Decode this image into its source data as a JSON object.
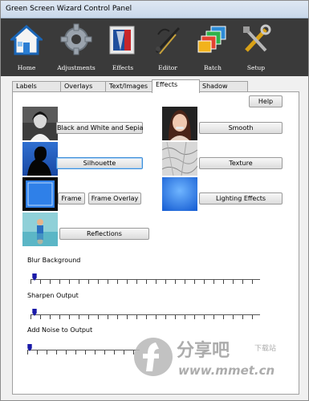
{
  "window": {
    "title": "Green Screen Wizard Control Panel"
  },
  "toolbar": {
    "items": [
      {
        "label": "Home",
        "icon": "home-icon"
      },
      {
        "label": "Adjustments",
        "icon": "gear-icon"
      },
      {
        "label": "Effects",
        "icon": "effects-icon"
      },
      {
        "label": "Editor",
        "icon": "editor-icon"
      },
      {
        "label": "Batch",
        "icon": "batch-icon"
      },
      {
        "label": "Setup",
        "icon": "setup-icon"
      }
    ]
  },
  "tabs": [
    {
      "label": "Labels"
    },
    {
      "label": "Overlays"
    },
    {
      "label": "Text/Images"
    },
    {
      "label": "Effects",
      "active": true
    },
    {
      "label": "Shadow"
    }
  ],
  "effects": {
    "help": "Help",
    "bw_sepia": "Black and White and Sepia",
    "silhouette": "Silhouette",
    "frame": "Frame",
    "frame_overlay": "Frame Overlay",
    "reflections": "Reflections",
    "smooth": "Smooth",
    "texture": "Texture",
    "lighting": "Lighting Effects"
  },
  "sliders": [
    {
      "label": "Blur Background",
      "value": 0.03
    },
    {
      "label": "Sharpen Output",
      "value": 0.03
    },
    {
      "label": "Add Noise to Output",
      "value": 0.0
    }
  ],
  "watermark": {
    "brand": "分享吧",
    "download": "下载站",
    "url": "www.mmet.cn"
  },
  "colors": {
    "toolbar_bg": "#3a3a3a",
    "focus_blue": "#3c8ed8",
    "slider_handle": "#1a1aa8"
  }
}
